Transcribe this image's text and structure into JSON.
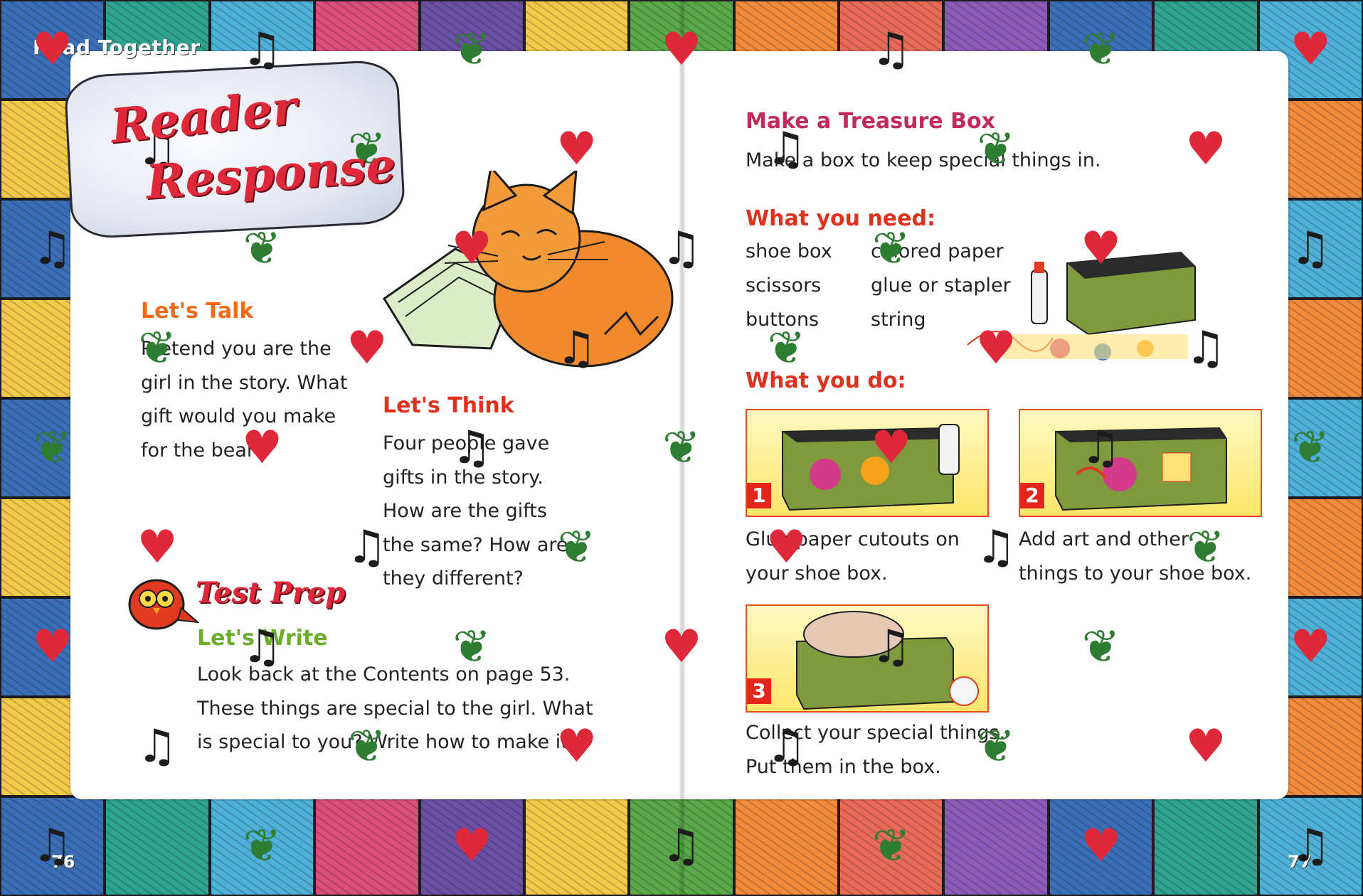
{
  "header": {
    "read_together": "Read Together"
  },
  "title": {
    "line1": "Reader",
    "line2": "Response"
  },
  "left": {
    "lets_talk": {
      "heading": "Let's Talk",
      "lines": [
        "Pretend you are the",
        "girl in the story. What",
        "gift would you make",
        "for the bear?"
      ]
    },
    "lets_think": {
      "heading": "Let's Think",
      "lines": [
        "Four people gave",
        "gifts in the story.",
        "How are the gifts",
        "the same? How are",
        "they different?"
      ]
    },
    "test_prep": {
      "label": "Test Prep"
    },
    "lets_write": {
      "heading": "Let's Write",
      "lines": [
        "Look back at the Contents on page 53.",
        "These things are special to the girl. What",
        "is special to you? Write how to make it."
      ]
    },
    "page_number": "76"
  },
  "right": {
    "heading": "Make a Treasure Box",
    "intro": "Make a box to keep special things in.",
    "need_heading": "What you need:",
    "needs": [
      "shoe box",
      "colored paper",
      "scissors",
      "glue or stapler",
      "buttons",
      "string"
    ],
    "do_heading": "What you do:",
    "steps": [
      {
        "num": "1",
        "lines": [
          "Glue paper cutouts on",
          "your shoe box."
        ]
      },
      {
        "num": "2",
        "lines": [
          "Add art and other",
          "things to your shoe box."
        ]
      },
      {
        "num": "3",
        "lines": [
          "Collect your special things.",
          "Put them in the box."
        ]
      }
    ],
    "page_number": "77"
  },
  "colors": {
    "orange_heading": "#f06a1a",
    "red_heading": "#e0301e",
    "green_heading": "#6cae2b",
    "magenta_heading": "#c22a5c",
    "title_red": "#e0283b"
  },
  "border_icons": [
    "heart-icon",
    "star-icon",
    "music-note-icon",
    "leaf-icon",
    "flower-icon",
    "cherries-icon",
    "sun-icon",
    "house-icon",
    "bear-icon"
  ]
}
